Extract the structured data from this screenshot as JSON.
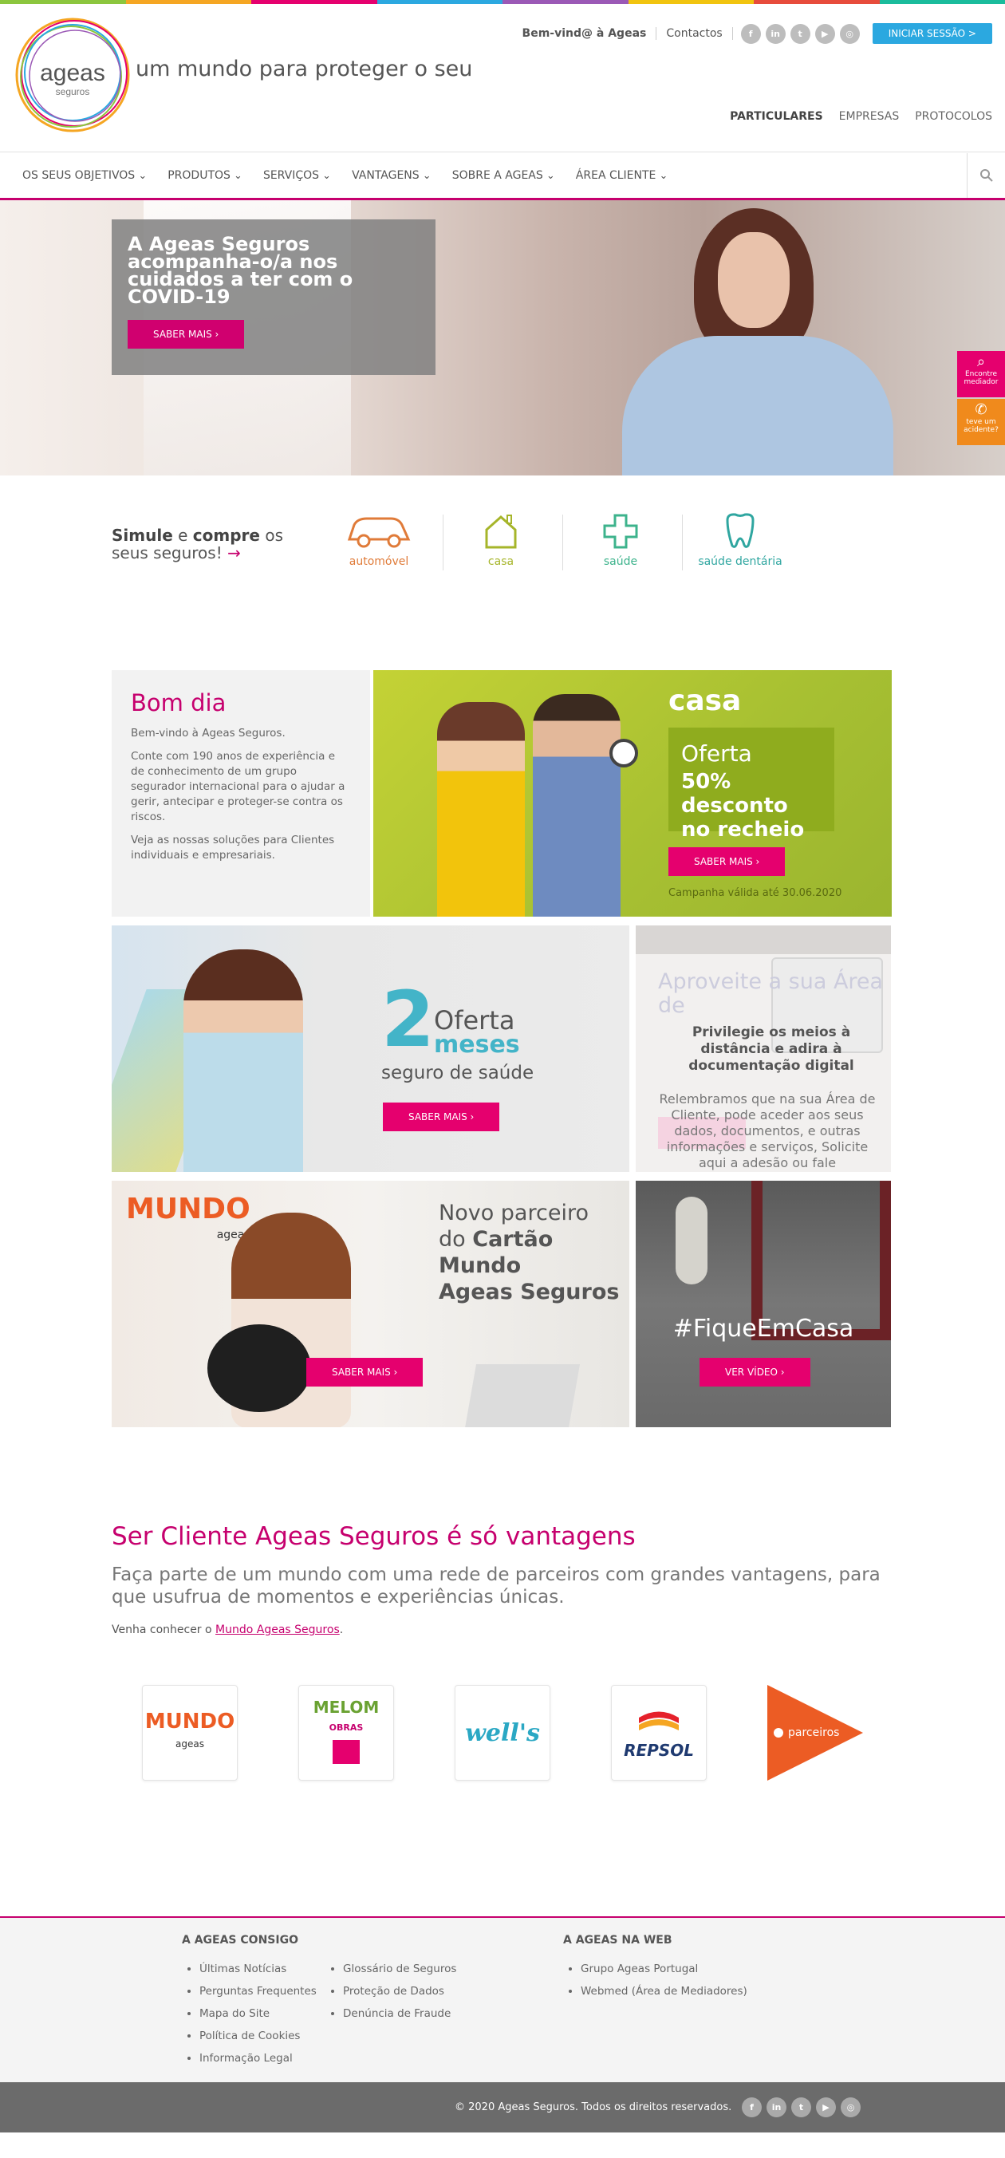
{
  "header": {
    "logo_name": "ageas",
    "logo_sub": "seguros",
    "tagline": "um mundo para proteger o seu",
    "welcome": "Bem-vind@ à Ageas",
    "contacts": "Contactos",
    "social": [
      "f",
      "in",
      "t",
      "▶",
      "◎"
    ],
    "login": "INICIAR SESSÃO  >",
    "segments": [
      "PARTICULARES",
      "EMPRESAS",
      "PROTOCOLOS"
    ]
  },
  "nav": {
    "items": [
      "OS SEUS OBJETIVOS",
      "PRODUTOS",
      "SERVIÇOS",
      "VANTAGENS",
      "SOBRE A AGEAS",
      "ÁREA CLIENTE"
    ],
    "search_icon": "🔍"
  },
  "hero": {
    "title": "A Ageas Seguros acompanha-o/a nos cuidados a ter com o COVID-19",
    "button": "SABER MAIS  ›"
  },
  "side_widgets": [
    {
      "label": "Encontre mediador",
      "icon": "⌕",
      "color": "#e5006e"
    },
    {
      "label": "teve um acidente?",
      "icon": "✆",
      "color": "#f08a1c"
    }
  ],
  "simulate": {
    "text_bold1": "Simule",
    "text_mid": " e ",
    "text_bold2": "compre",
    "text_end": " os",
    "line2": "seus seguros!",
    "arrow": "→",
    "products": [
      {
        "label": "automóvel",
        "icon": "🚗",
        "color": "#e07b39"
      },
      {
        "label": "casa",
        "icon": "⌂",
        "color": "#a6b52a"
      },
      {
        "label": "saúde",
        "icon": "✚",
        "color": "#3db38c"
      },
      {
        "label": "saúde dentária",
        "icon": "🦷",
        "color": "#2fa6a0"
      }
    ]
  },
  "bomdia": {
    "title": "Bom dia",
    "p1": "Bem-vindo à Ageas Seguros.",
    "p2": "Conte com 190 anos de experiência e de conhecimento de um grupo segurador internacional para o ajudar a gerir, antecipar e proteger-se contra os riscos.",
    "p3": "Veja as nossas soluções para Clientes individuais e empresariais."
  },
  "casa_tile": {
    "logo": "casa",
    "offer1": "Oferta",
    "offer2": "50% desconto no recheio",
    "button": "SABER MAIS  ›",
    "campaign": "Campanha válida até 30.06.2020"
  },
  "saude_tile": {
    "big": "2",
    "oferta": "Oferta",
    "meses": "meses",
    "seguro": "seguro de saúde",
    "button": "SABER MAIS  ›"
  },
  "digital_tile": {
    "ghost": "Aproveite a sua Área de",
    "title": "Privilegie os meios à distância e adira à documentação digital",
    "desc": "Relembramos que na sua Área de Cliente, pode aceder aos seus dados, documentos, e outras informações e serviços, Solicite aqui a adesão ou fale"
  },
  "mundo_tile": {
    "logo": "MUNDO",
    "logo_sub": "ageas",
    "text1": "Novo parceiro",
    "text2": "do ",
    "text2b": "Cartão Mundo",
    "text3": "Ageas Seguros",
    "button": "SABER MAIS  ›"
  },
  "fique_tile": {
    "title": "#FiqueEmCasa",
    "button": "VER VÍDEO  ›"
  },
  "vantagens": {
    "title": "Ser Cliente Ageas Seguros é só vantagens",
    "subtitle": "Faça parte de um mundo com uma rede de parceiros com grandes vantagens, para que usufrua de momentos e experiências únicas.",
    "venha": "Venha conhecer o ",
    "link": "Mundo Ageas Seguros",
    "period": ".",
    "partners": [
      {
        "label": "MUNDO",
        "sub": "ageas"
      },
      {
        "label": "MELOM",
        "sub": "OBRAS"
      },
      {
        "label": "well's",
        "sub": ""
      },
      {
        "label": "REPSOL",
        "sub": ""
      },
      {
        "label": "parceiros",
        "sub": ""
      }
    ]
  },
  "footer": {
    "col1_title": "A AGEAS CONSIGO",
    "col1a": [
      "Últimas Notícias",
      "Perguntas Frequentes",
      "Mapa do Site",
      "Política de Cookies",
      "Informação Legal"
    ],
    "col1b": [
      "Glossário de Seguros",
      "Proteção de Dados",
      "Denúncia de Fraude"
    ],
    "col2_title": "A AGEAS NA WEB",
    "col2": [
      "Grupo Ageas Portugal",
      "Webmed (Área de Mediadores)"
    ],
    "copyright": "© 2020 Ageas Seguros. Todos os direitos reservados."
  },
  "colors": {
    "magenta": "#c6006e",
    "button_pink": "#e5006e",
    "login_blue": "#2ba8e0",
    "topbar": [
      "#8cc63e",
      "#f5a623",
      "#e5006e",
      "#2ba8e0",
      "#9b59b6",
      "#f1c40f",
      "#e74c3c",
      "#1abc9c"
    ]
  }
}
